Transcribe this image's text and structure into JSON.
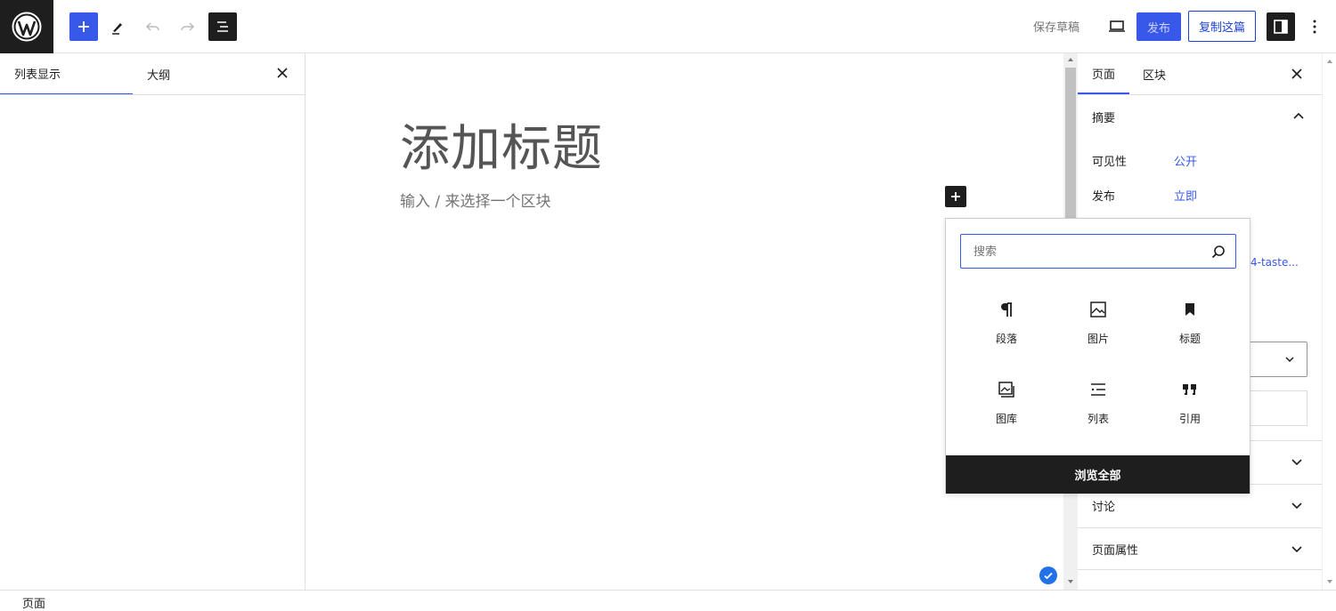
{
  "toolbar": {
    "save_draft": "保存草稿",
    "publish": "发布",
    "copy": "复制这篇"
  },
  "left_panel": {
    "tabs": [
      "列表显示",
      "大纲"
    ]
  },
  "canvas": {
    "title_placeholder": "添加标题",
    "block_placeholder": "输入 / 来选择一个区块"
  },
  "sidebar": {
    "tabs": [
      "页面",
      "区块"
    ],
    "summary": {
      "title": "摘要",
      "visibility_label": "可见性",
      "visibility_value": "公开",
      "publish_label": "发布",
      "publish_value": "立即",
      "url_value": "4-taste..."
    },
    "panels": [
      "讨论",
      "页面属性"
    ]
  },
  "inserter": {
    "search_placeholder": "搜索",
    "blocks": [
      {
        "label": "段落",
        "icon": "paragraph-icon"
      },
      {
        "label": "图片",
        "icon": "image-icon"
      },
      {
        "label": "标题",
        "icon": "heading-bookmark-icon"
      },
      {
        "label": "图库",
        "icon": "gallery-icon"
      },
      {
        "label": "列表",
        "icon": "list-icon"
      },
      {
        "label": "引用",
        "icon": "quote-icon"
      }
    ],
    "browse_all": "浏览全部"
  },
  "footer": {
    "breadcrumb": "页面"
  },
  "colors": {
    "accent": "#3858e9",
    "dark": "#1e1e1e",
    "link": "#3858e9"
  }
}
